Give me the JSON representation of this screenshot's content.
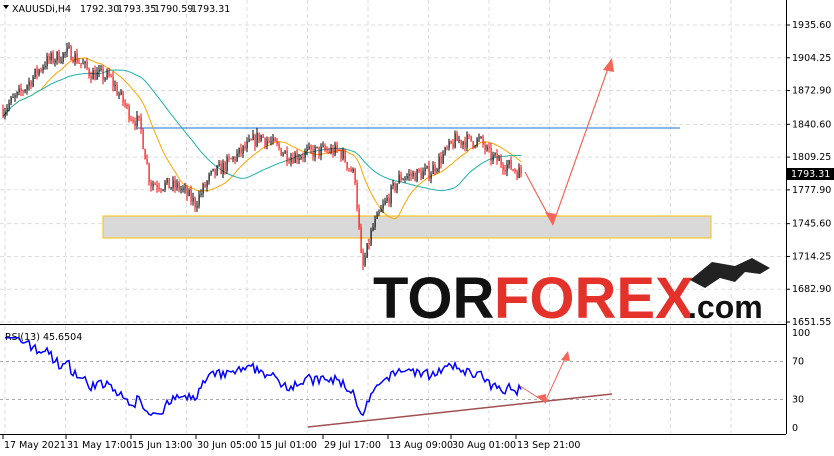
{
  "header": {
    "symbol": "XAUUSDi,H4",
    "open": "1792.30",
    "high": "1793.35",
    "low": "1790.59",
    "close": "1793.31"
  },
  "price_axis": [
    "1935.60",
    "1904.25",
    "1872.90",
    "1840.60",
    "1809.25",
    "1777.90",
    "1745.60",
    "1714.25",
    "1682.90",
    "1651.55"
  ],
  "current_price": "1793.31",
  "rsi": {
    "label": "RSI(13) 45.6504",
    "levels": [
      "100",
      "70",
      "30",
      "0"
    ]
  },
  "time_axis": [
    "17 May 2021",
    "31 May 17:00",
    "15 Jun 13:00",
    "30 Jun 05:00",
    "15 Jul 01:00",
    "29 Jul 17:00",
    "13 Aug 09:00",
    "30 Aug 01:00",
    "13 Sep 21:00"
  ],
  "logo": {
    "part1": "TOR",
    "part2": "FOREX",
    "part3": ".com"
  },
  "colors": {
    "bull": "#000000",
    "bear": "#ff0000",
    "ma_fast": "#ffa500",
    "ma_slow": "#20b2aa",
    "rsi": "#0000ff",
    "resistance": "#1e6fd9",
    "arrow": "#f4655a",
    "zone_border": "#ffc000"
  },
  "chart_data": {
    "type": "line",
    "title": "XAUUSDi,H4",
    "ylim": [
      1651.55,
      1950
    ],
    "key_prices": [
      1855,
      1870,
      1900,
      1910,
      1890,
      1885,
      1850,
      1840,
      1785,
      1780,
      1765,
      1790,
      1805,
      1830,
      1810,
      1815,
      1815,
      1790,
      1700,
      1740,
      1765,
      1790,
      1795,
      1825,
      1825,
      1810,
      1800,
      1793.31
    ],
    "resistance_level": 1840,
    "support_zone": [
      1735,
      1755
    ],
    "forecast": [
      1793.31,
      1745,
      1905
    ]
  }
}
